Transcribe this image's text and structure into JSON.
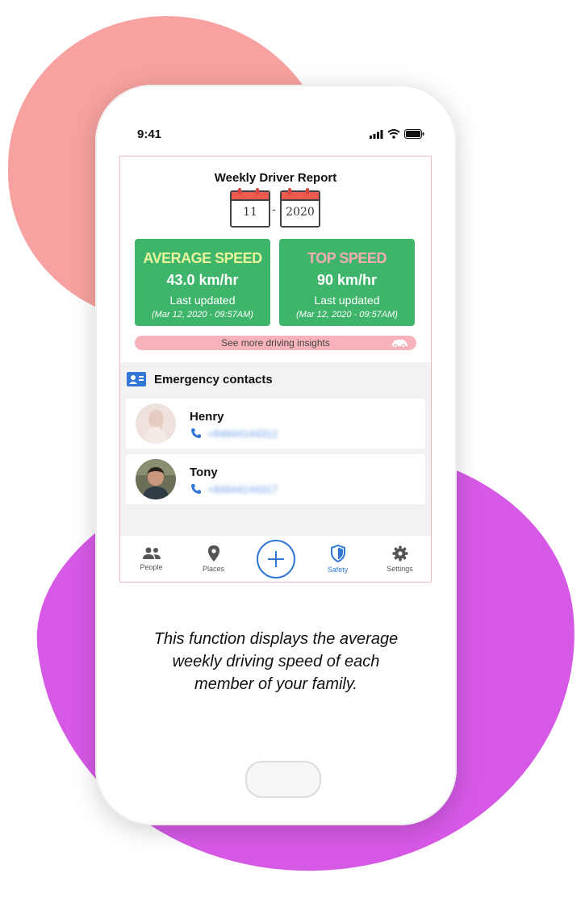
{
  "status_bar": {
    "time": "9:41"
  },
  "report": {
    "title": "Weekly Driver Report",
    "week": "11",
    "separator": "-",
    "year": "2020",
    "average_speed": {
      "heading": "AVERAGE SPEED",
      "value": "43.0 km/hr",
      "updated_label": "Last updated",
      "updated_date": "(Mar 12, 2020 - 09:57AM)"
    },
    "top_speed": {
      "heading": "TOP SPEED",
      "value": "90 km/hr",
      "updated_label": "Last updated",
      "updated_date": "(Mar 12, 2020 - 09:57AM)"
    },
    "insights_label": "See more driving insights"
  },
  "emergency": {
    "title": "Emergency contacts",
    "contacts": [
      {
        "name": "Henry",
        "phone": "+84944144312"
      },
      {
        "name": "Tony",
        "phone": "+84944144317"
      }
    ]
  },
  "tabbar": {
    "tabs": [
      {
        "label": "People",
        "icon": "people-icon"
      },
      {
        "label": "Places",
        "icon": "map-pin-icon"
      },
      {
        "label": "",
        "icon": "add-icon"
      },
      {
        "label": "Safety",
        "icon": "shield-icon",
        "active": true
      },
      {
        "label": "Settings",
        "icon": "gear-icon"
      }
    ]
  },
  "caption": {
    "line1": "This function displays the average",
    "line2": "weekly driving speed of each",
    "line3": "member of your family."
  },
  "colors": {
    "accent": "#3277d6",
    "speed_box": "#3fb56b",
    "pink_blob": "#f7a2a0",
    "purple_blob": "#d659e6"
  }
}
